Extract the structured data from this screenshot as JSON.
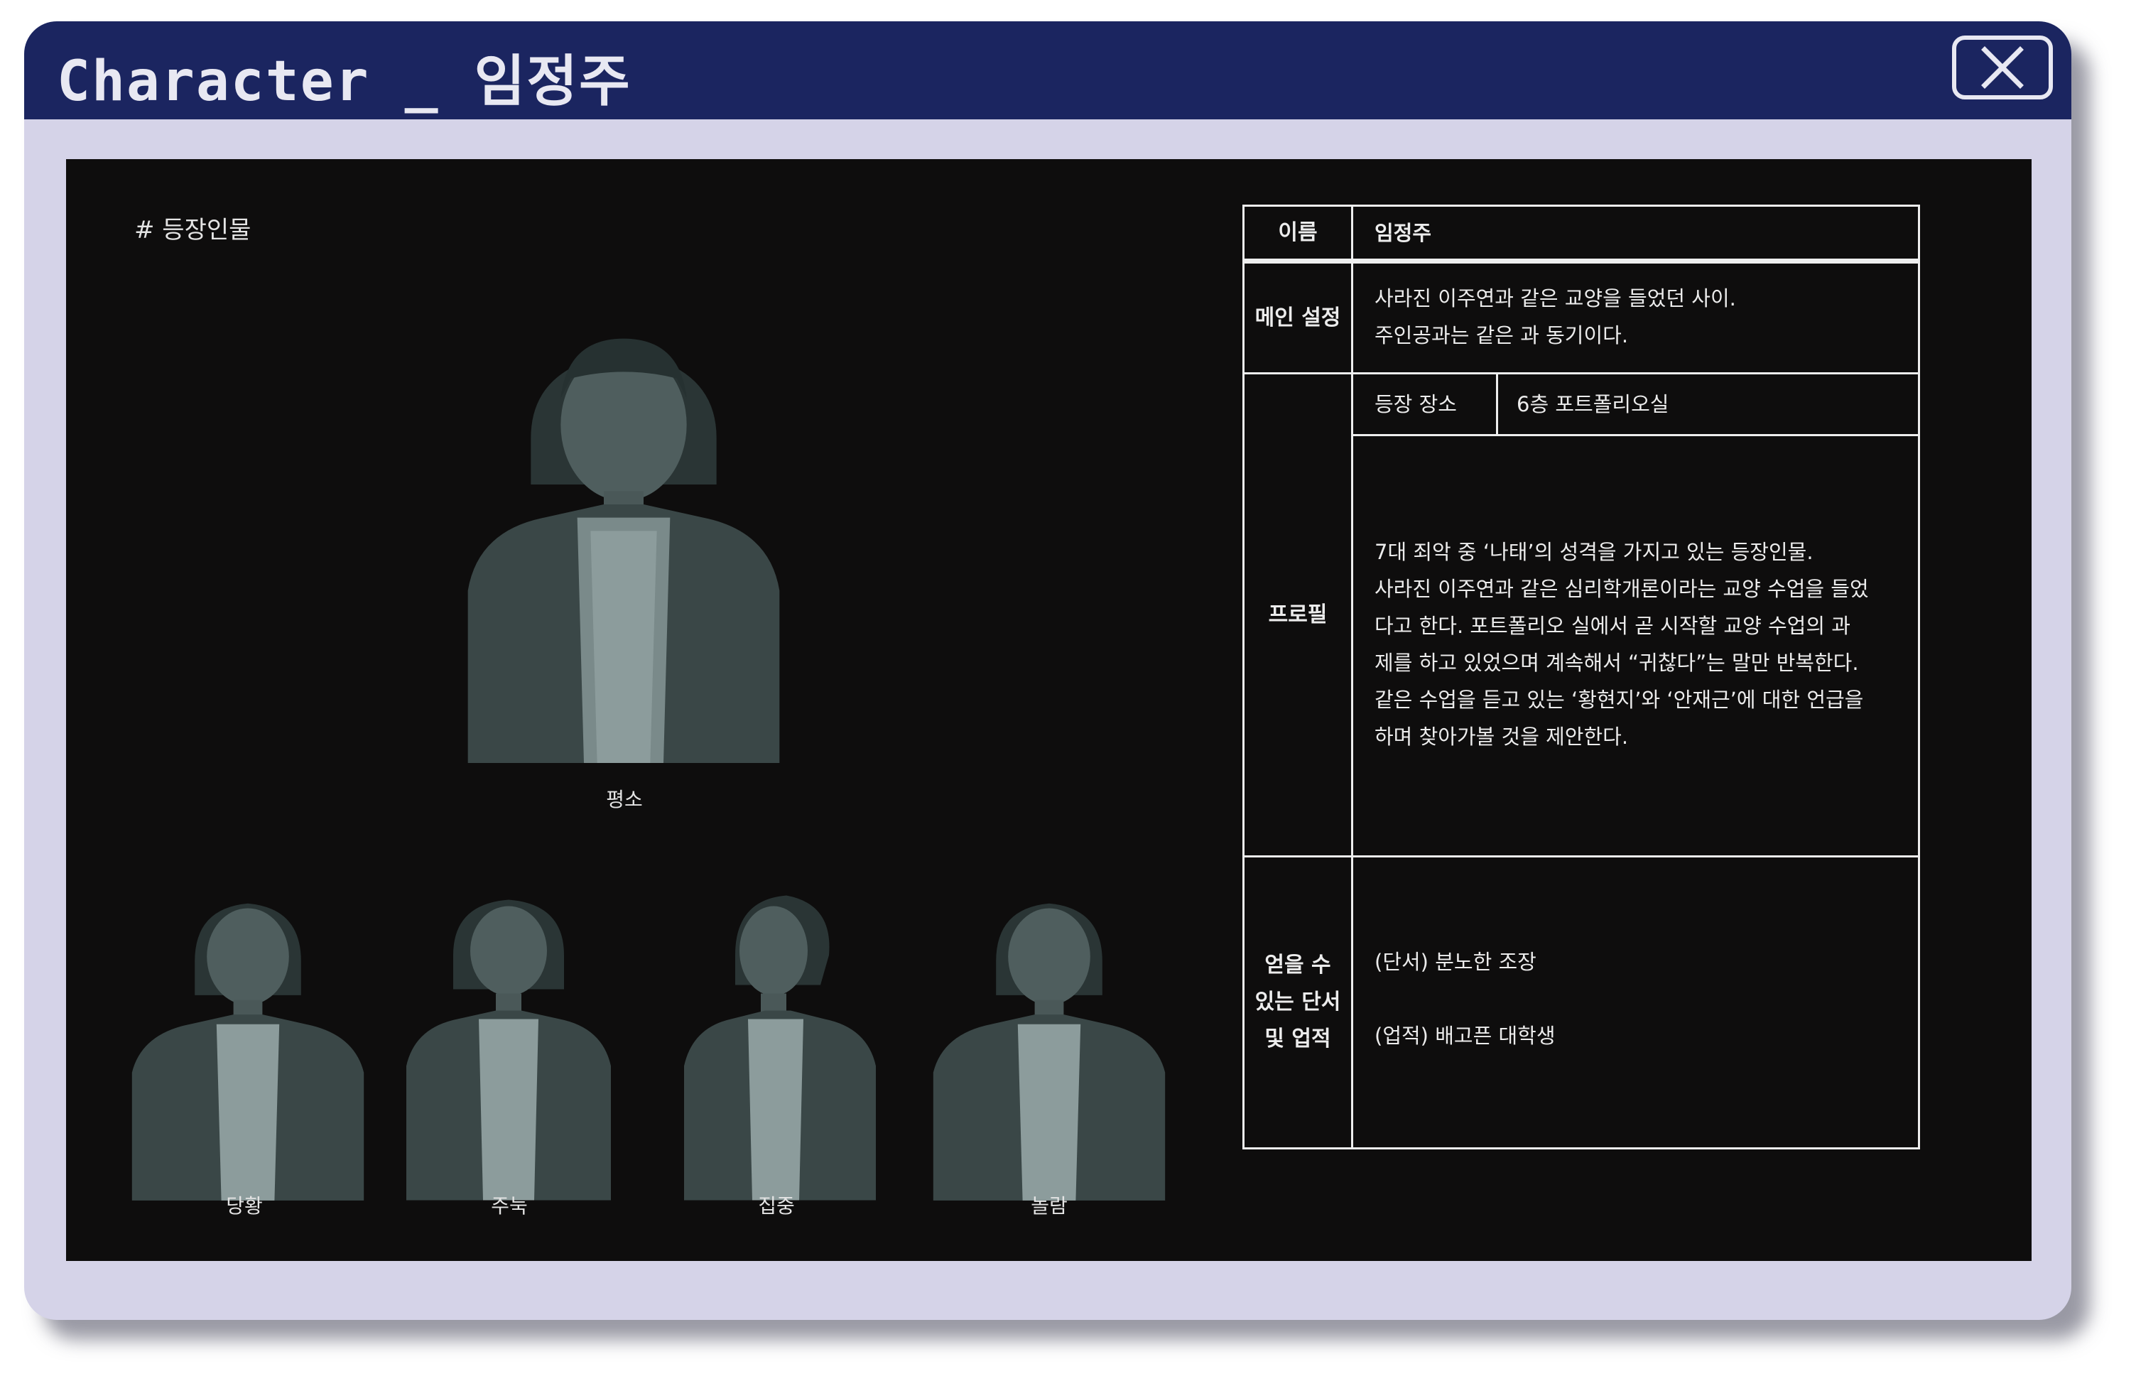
{
  "window": {
    "title": "Character _ 임정주",
    "close_icon": "close-icon",
    "colors": {
      "frame": "#d5d3e8",
      "titlebar": "#1b2560",
      "content_bg": "#0e0d0d",
      "text": "#e4e4e4"
    }
  },
  "gallery": {
    "section_label": "# 등장인물",
    "main": {
      "caption": "평소"
    },
    "expressions": [
      {
        "caption": "당황"
      },
      {
        "caption": "주눅"
      },
      {
        "caption": "집중"
      },
      {
        "caption": "놀람"
      }
    ]
  },
  "info": {
    "name_header": "이름",
    "name_value": "임정주",
    "main_setting_header": "메인 설정",
    "main_setting_lines": [
      "사라진 이주연과 같은 교양을 들었던 사이.",
      "주인공과는 같은 과 동기이다."
    ],
    "profile_header": "프로필",
    "location_label": "등장 장소",
    "location_value": "6층 포트폴리오실",
    "profile_lines": [
      "7대 죄악 중 ‘나태’의 성격을 가지고 있는 등장인물.",
      "사라진 이주연과 같은 심리학개론이라는 교양 수업을 들었",
      "다고 한다. 포트폴리오 실에서 곧 시작할 교양 수업의 과",
      "제를 하고 있었으며 계속해서 “귀찮다”는 말만 반복한다.",
      "같은 수업을 듣고 있는 ‘황현지’와 ‘안재근’에 대한 언급을",
      "하며 찾아가볼 것을 제안한다."
    ],
    "obtainable_header_lines": [
      "얻을 수",
      "있는 단서",
      "및 업적"
    ],
    "clue": "(단서) 분노한 조장",
    "achievement": "(업적) 배고픈 대학생"
  }
}
